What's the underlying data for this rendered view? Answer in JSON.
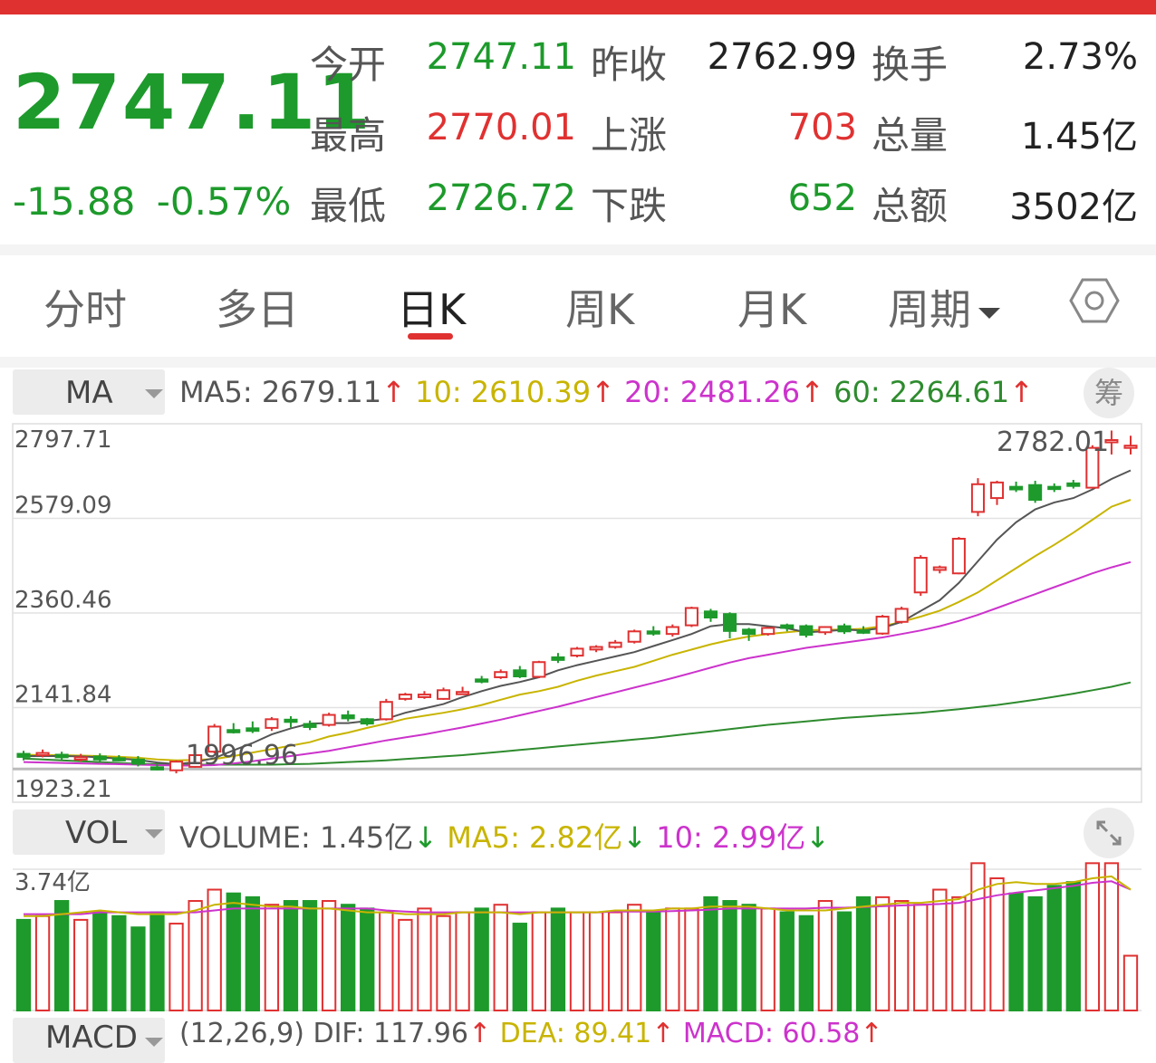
{
  "quote": {
    "price": "2747.11",
    "change": "-15.88",
    "change_pct": "-0.57%",
    "rows": [
      {
        "l1": "今开",
        "v1": "2747.11",
        "c1": "green",
        "l2": "昨收",
        "v2": "2762.99",
        "c2": "black",
        "l3": "换手",
        "v3": "2.73%"
      },
      {
        "l1": "最高",
        "v1": "2770.01",
        "c1": "red",
        "l2": "上涨",
        "v2": "703",
        "c2": "red",
        "l3": "总量",
        "v3": "1.45亿"
      },
      {
        "l1": "最低",
        "v1": "2726.72",
        "c1": "green",
        "l2": "下跌",
        "v2": "652",
        "c2": "green",
        "l3": "总额",
        "v3": "3502亿"
      }
    ]
  },
  "tabs": [
    {
      "label": "分时",
      "active": false
    },
    {
      "label": "多日",
      "active": false
    },
    {
      "label": "日K",
      "active": true
    },
    {
      "label": "周K",
      "active": false
    },
    {
      "label": "月K",
      "active": false
    },
    {
      "label": "周期",
      "active": false
    }
  ],
  "ma_panel": {
    "selector": "MA",
    "ma5": "MA5: 2679.11",
    "ma10": "10: 2610.39",
    "ma20": "20: 2481.26",
    "ma60": "60: 2264.61",
    "arrow": "↑",
    "chip_button": "筹"
  },
  "vol_panel": {
    "selector": "VOL",
    "volume": "VOLUME: 1.45亿",
    "ma5": "MA5: 2.82亿",
    "ma10": "10: 2.99亿",
    "arrow": "↓",
    "y_max_label": "3.74亿"
  },
  "macd_panel": {
    "selector": "MACD",
    "params": "(12,26,9)",
    "dif": "DIF: 117.96",
    "dea": "DEA: 89.41",
    "macd": "MACD: 60.58",
    "arrow": "↑"
  },
  "colors": {
    "up": "#e03131",
    "down": "#1d9a2b",
    "ma5": "#555555",
    "ma10": "#c8b400",
    "ma20": "#cc33cc",
    "ma60": "#2e8b2e",
    "accent": "#e03131"
  },
  "chart_data": {
    "type": "candlestick",
    "y_ticks": [
      2797.71,
      2579.09,
      2360.46,
      2141.84,
      1923.21
    ],
    "y_tick_labels": [
      "2797.71",
      "2579.09",
      "2360.46",
      "2141.84",
      "1923.21"
    ],
    "ylim": [
      1923.21,
      2797.71
    ],
    "max_label": "2782.01",
    "min_label": "1996.96",
    "candles": [
      [
        2035,
        2028,
        2042,
        2020
      ],
      [
        2035,
        2037,
        2045,
        2027
      ],
      [
        2033,
        2027,
        2040,
        2020
      ],
      [
        2022,
        2027,
        2035,
        2017
      ],
      [
        2029,
        2022,
        2036,
        2016
      ],
      [
        2025,
        2024,
        2032,
        2018
      ],
      [
        2022,
        2012,
        2030,
        2006
      ],
      [
        2004,
        2002,
        2012,
        1996.96
      ],
      [
        1996.96,
        2017,
        2020,
        1990
      ],
      [
        2005,
        2032,
        2040,
        2003
      ],
      [
        2040,
        2098,
        2104,
        2036
      ],
      [
        2090,
        2088,
        2106,
        2082
      ],
      [
        2094,
        2088,
        2110,
        2083
      ],
      [
        2095,
        2115,
        2120,
        2088
      ],
      [
        2114,
        2110,
        2122,
        2096
      ],
      [
        2104,
        2097,
        2112,
        2090
      ],
      [
        2102,
        2125,
        2130,
        2098
      ],
      [
        2124,
        2117,
        2135,
        2110
      ],
      [
        2115,
        2105,
        2118,
        2100
      ],
      [
        2115,
        2155,
        2162,
        2112
      ],
      [
        2162,
        2172,
        2176,
        2158
      ],
      [
        2166,
        2172,
        2180,
        2162
      ],
      [
        2162,
        2182,
        2188,
        2160
      ],
      [
        2178,
        2178,
        2190,
        2172
      ],
      [
        2207,
        2203,
        2215,
        2198
      ],
      [
        2212,
        2224,
        2230,
        2208
      ],
      [
        2228,
        2214,
        2238,
        2210
      ],
      [
        2213,
        2247,
        2250,
        2210
      ],
      [
        2258,
        2252,
        2268,
        2245
      ],
      [
        2262,
        2278,
        2282,
        2258
      ],
      [
        2276,
        2282,
        2286,
        2270
      ],
      [
        2282,
        2292,
        2298,
        2278
      ],
      [
        2294,
        2318,
        2322,
        2290
      ],
      [
        2318,
        2314,
        2330,
        2308
      ],
      [
        2312,
        2328,
        2334,
        2306
      ],
      [
        2332,
        2372,
        2375,
        2328
      ],
      [
        2364,
        2350,
        2370,
        2340
      ],
      [
        2358,
        2319,
        2362,
        2302
      ],
      [
        2322,
        2312,
        2326,
        2296
      ],
      [
        2312,
        2326,
        2328,
        2308
      ],
      [
        2332,
        2326,
        2336,
        2318
      ],
      [
        2330,
        2310,
        2334,
        2304
      ],
      [
        2316,
        2328,
        2330,
        2310
      ],
      [
        2330,
        2318,
        2336,
        2312
      ],
      [
        2320,
        2316,
        2330,
        2312
      ],
      [
        2313,
        2352,
        2356,
        2310
      ],
      [
        2340,
        2370,
        2375,
        2336
      ],
      [
        2408,
        2488,
        2494,
        2400
      ],
      [
        2460,
        2466,
        2470,
        2452
      ],
      [
        2452,
        2532,
        2536,
        2450
      ],
      [
        2594,
        2658,
        2672,
        2584
      ],
      [
        2626,
        2662,
        2666,
        2610
      ],
      [
        2652,
        2646,
        2664,
        2640
      ],
      [
        2656,
        2622,
        2666,
        2615
      ],
      [
        2652,
        2648,
        2660,
        2640
      ],
      [
        2660,
        2654,
        2668,
        2648
      ],
      [
        2650,
        2742,
        2748,
        2648
      ],
      [
        2755,
        2760,
        2782.01,
        2726.72
      ],
      [
        2747.11,
        2747.11,
        2770.01,
        2726.72
      ]
    ],
    "ma5": [
      2030,
      2030,
      2030,
      2029,
      2027,
      2024,
      2021,
      2015,
      2011,
      2016,
      2025,
      2043,
      2060,
      2080,
      2094,
      2105,
      2106,
      2106,
      2111,
      2116,
      2130,
      2140,
      2150,
      2166,
      2180,
      2192,
      2201,
      2212,
      2228,
      2240,
      2250,
      2260,
      2270,
      2284,
      2298,
      2312,
      2330,
      2335,
      2335,
      2330,
      2325,
      2316,
      2318,
      2322,
      2320,
      2326,
      2340,
      2365,
      2390,
      2430,
      2480,
      2530,
      2570,
      2600,
      2616,
      2626,
      2646,
      2670,
      2690
    ],
    "ma10": [
      2033,
      2032,
      2032,
      2031,
      2030,
      2028,
      2026,
      2022,
      2020,
      2021,
      2023,
      2030,
      2038,
      2046,
      2054,
      2062,
      2075,
      2084,
      2095,
      2105,
      2116,
      2123,
      2130,
      2138,
      2148,
      2160,
      2172,
      2180,
      2190,
      2204,
      2216,
      2226,
      2236,
      2250,
      2264,
      2276,
      2288,
      2298,
      2306,
      2312,
      2316,
      2320,
      2322,
      2322,
      2324,
      2330,
      2340,
      2352,
      2366,
      2386,
      2408,
      2436,
      2464,
      2492,
      2518,
      2546,
      2576,
      2606,
      2622
    ],
    "ma20": [
      2016,
      2015,
      2014,
      2013,
      2012,
      2011,
      2010,
      2009,
      2008,
      2008,
      2009,
      2013,
      2018,
      2024,
      2030,
      2036,
      2042,
      2050,
      2058,
      2066,
      2073,
      2080,
      2088,
      2096,
      2105,
      2114,
      2124,
      2134,
      2144,
      2155,
      2166,
      2177,
      2188,
      2199,
      2210,
      2222,
      2234,
      2246,
      2256,
      2264,
      2272,
      2280,
      2286,
      2292,
      2298,
      2304,
      2312,
      2320,
      2330,
      2342,
      2356,
      2372,
      2388,
      2404,
      2420,
      2436,
      2452,
      2466,
      2478
    ],
    "ma60": [
      2024,
      2022,
      2020,
      2018,
      2016,
      2014,
      2012,
      2011,
      2010,
      2010,
      2010,
      2010,
      2010,
      2010,
      2011,
      2012,
      2014,
      2016,
      2018,
      2020,
      2023,
      2026,
      2029,
      2032,
      2036,
      2040,
      2044,
      2048,
      2052,
      2056,
      2060,
      2064,
      2068,
      2072,
      2077,
      2082,
      2087,
      2092,
      2097,
      2102,
      2106,
      2110,
      2114,
      2118,
      2121,
      2124,
      2127,
      2130,
      2134,
      2138,
      2143,
      2148,
      2154,
      2160,
      2167,
      2174,
      2182,
      2190,
      2200
    ],
    "volume": {
      "ylim": [
        0,
        3.74
      ],
      "values": [
        2.4,
        2.5,
        2.9,
        2.4,
        2.6,
        2.5,
        2.2,
        2.6,
        2.3,
        2.9,
        3.2,
        3.1,
        3.0,
        2.8,
        2.9,
        2.9,
        2.9,
        2.8,
        2.7,
        2.6,
        2.4,
        2.7,
        2.5,
        2.6,
        2.7,
        2.8,
        2.3,
        2.6,
        2.7,
        2.6,
        2.6,
        2.6,
        2.8,
        2.6,
        2.7,
        2.7,
        3.0,
        2.9,
        2.8,
        2.7,
        2.6,
        2.5,
        2.9,
        2.6,
        3.0,
        3.0,
        2.9,
        2.8,
        3.2,
        3.0,
        3.9,
        3.5,
        3.1,
        3.0,
        3.3,
        3.4,
        3.9,
        3.9,
        1.45
      ],
      "ma5": [
        2.5,
        2.5,
        2.55,
        2.6,
        2.65,
        2.6,
        2.55,
        2.55,
        2.55,
        2.65,
        2.8,
        2.85,
        2.8,
        2.75,
        2.75,
        2.7,
        2.7,
        2.65,
        2.6,
        2.6,
        2.55,
        2.55,
        2.55,
        2.6,
        2.6,
        2.6,
        2.55,
        2.6,
        2.6,
        2.6,
        2.6,
        2.65,
        2.65,
        2.65,
        2.7,
        2.7,
        2.75,
        2.75,
        2.75,
        2.7,
        2.65,
        2.65,
        2.65,
        2.7,
        2.75,
        2.8,
        2.85,
        2.85,
        2.9,
        2.95,
        3.2,
        3.35,
        3.4,
        3.35,
        3.35,
        3.4,
        3.5,
        3.55,
        3.2
      ],
      "ma10": [
        2.55,
        2.55,
        2.55,
        2.55,
        2.6,
        2.6,
        2.6,
        2.6,
        2.6,
        2.6,
        2.65,
        2.7,
        2.7,
        2.7,
        2.7,
        2.7,
        2.7,
        2.7,
        2.7,
        2.65,
        2.62,
        2.6,
        2.6,
        2.6,
        2.6,
        2.6,
        2.6,
        2.6,
        2.6,
        2.6,
        2.6,
        2.62,
        2.62,
        2.62,
        2.63,
        2.65,
        2.67,
        2.7,
        2.7,
        2.7,
        2.7,
        2.7,
        2.72,
        2.72,
        2.74,
        2.76,
        2.78,
        2.8,
        2.82,
        2.85,
        2.95,
        3.05,
        3.12,
        3.18,
        3.24,
        3.3,
        3.38,
        3.42,
        3.2
      ]
    }
  }
}
